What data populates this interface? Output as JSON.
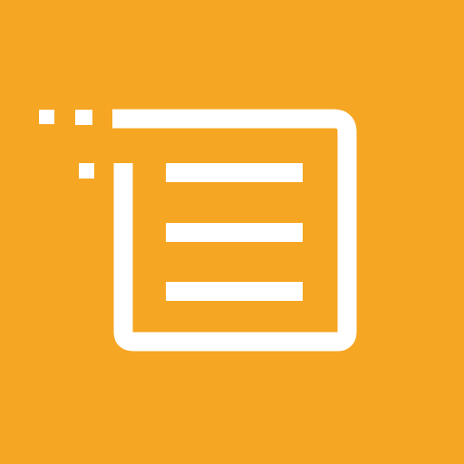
{
  "icon": {
    "name": "list-window-icon",
    "background_color": "#F5A623",
    "foreground_color": "#FFFFFF"
  }
}
